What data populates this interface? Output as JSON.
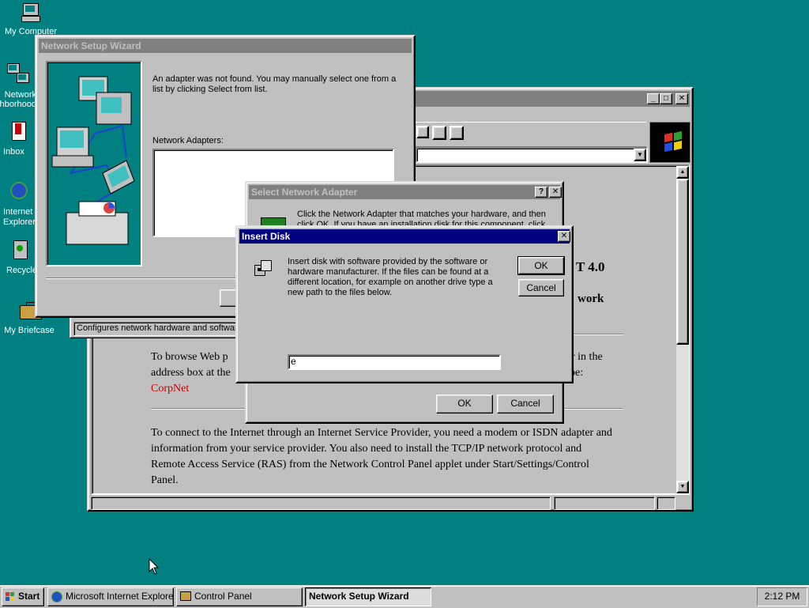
{
  "desktop": {
    "icons": [
      {
        "label": "My Computer",
        "icon": "my-computer-icon"
      },
      {
        "label": "Network Neighborhood",
        "icon": "network-neighborhood-icon"
      },
      {
        "label": "Inbox",
        "icon": "inbox-icon"
      },
      {
        "label": "Internet Explorer",
        "icon": "internet-explorer-icon"
      },
      {
        "label": "Recycle Bin",
        "icon": "recycle-bin-icon"
      },
      {
        "label": "My Briefcase",
        "icon": "briefcase-icon"
      }
    ]
  },
  "ie_window": {
    "window_buttons": {
      "minimize": "_",
      "maximize": "□",
      "close": "✕"
    },
    "heading_fragment": "T 4.0",
    "subheading_fragment": "work",
    "para1_part1": "To browse Web p",
    "para1_part1_right": "r in the",
    "para1_part2": "address box at the",
    "para1_part2_right": "pe:",
    "link_text": "CorpNet",
    "para2": "To connect to the Internet through an Internet Service Provider, you need a modem or ISDN adapter and information from your service provider. You also need to install the TCP/IP network protocol and Remote Access Service (RAS) from the Network Control Panel applet under Start/Settings/Control Panel."
  },
  "control_panel_status": "Configures network hardware and software",
  "wizard": {
    "title": "Network Setup Wizard",
    "message": "An adapter was not found. You may manually select one from a list by clicking Select from list.",
    "adapters_label": "Network Adapters:"
  },
  "select_adapter": {
    "title": "Select Network Adapter",
    "help_button": "?",
    "close_button": "✕",
    "message_line1": "Click the Network Adapter that matches your hardware, and then",
    "message_line2": "click OK.  If you have an installation disk for this component, click",
    "ok_label": "OK",
    "cancel_label": "Cancel"
  },
  "insert_disk": {
    "title": "Insert Disk",
    "close_button": "✕",
    "message": "Insert disk with software provided by the software or hardware manufacturer.  If the files can be found at a different location, for example on another drive type a new path to the files below.",
    "ok_label": "OK",
    "cancel_label": "Cancel",
    "path_value": "e"
  },
  "taskbar": {
    "start_label": "Start",
    "tasks": [
      {
        "label": "Microsoft Internet Explorer ...",
        "icon": "internet-explorer-icon"
      },
      {
        "label": "Control Panel",
        "icon": "control-panel-icon"
      },
      {
        "label": "Network Setup Wizard",
        "icon": ""
      }
    ],
    "clock": "2:12 PM"
  },
  "colors": {
    "desktop": "#008080",
    "titlebar_active": "#000080",
    "titlebar_inactive": "#808080",
    "face": "#c0c0c0",
    "link": "#cc0000"
  }
}
